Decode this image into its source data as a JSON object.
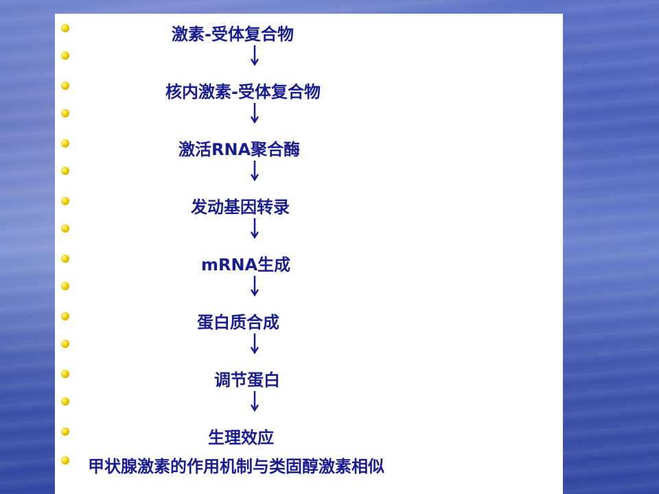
{
  "slide": {
    "steps": [
      "激素-受体复合物",
      "核内激素-受体复合物",
      "激活RNA聚合酶",
      "发动基因转录",
      "mRNA生成",
      "蛋白质合成",
      "调节蛋白",
      "生理效应"
    ],
    "arrow_glyph": "↓",
    "conclusion": "甲状腺激素的作用机制与类固醇激素相似"
  },
  "colors": {
    "text": "#1a1d8f",
    "bullet": "#f2d000",
    "panel": "#ffffff",
    "background": "#4a5eb8"
  }
}
